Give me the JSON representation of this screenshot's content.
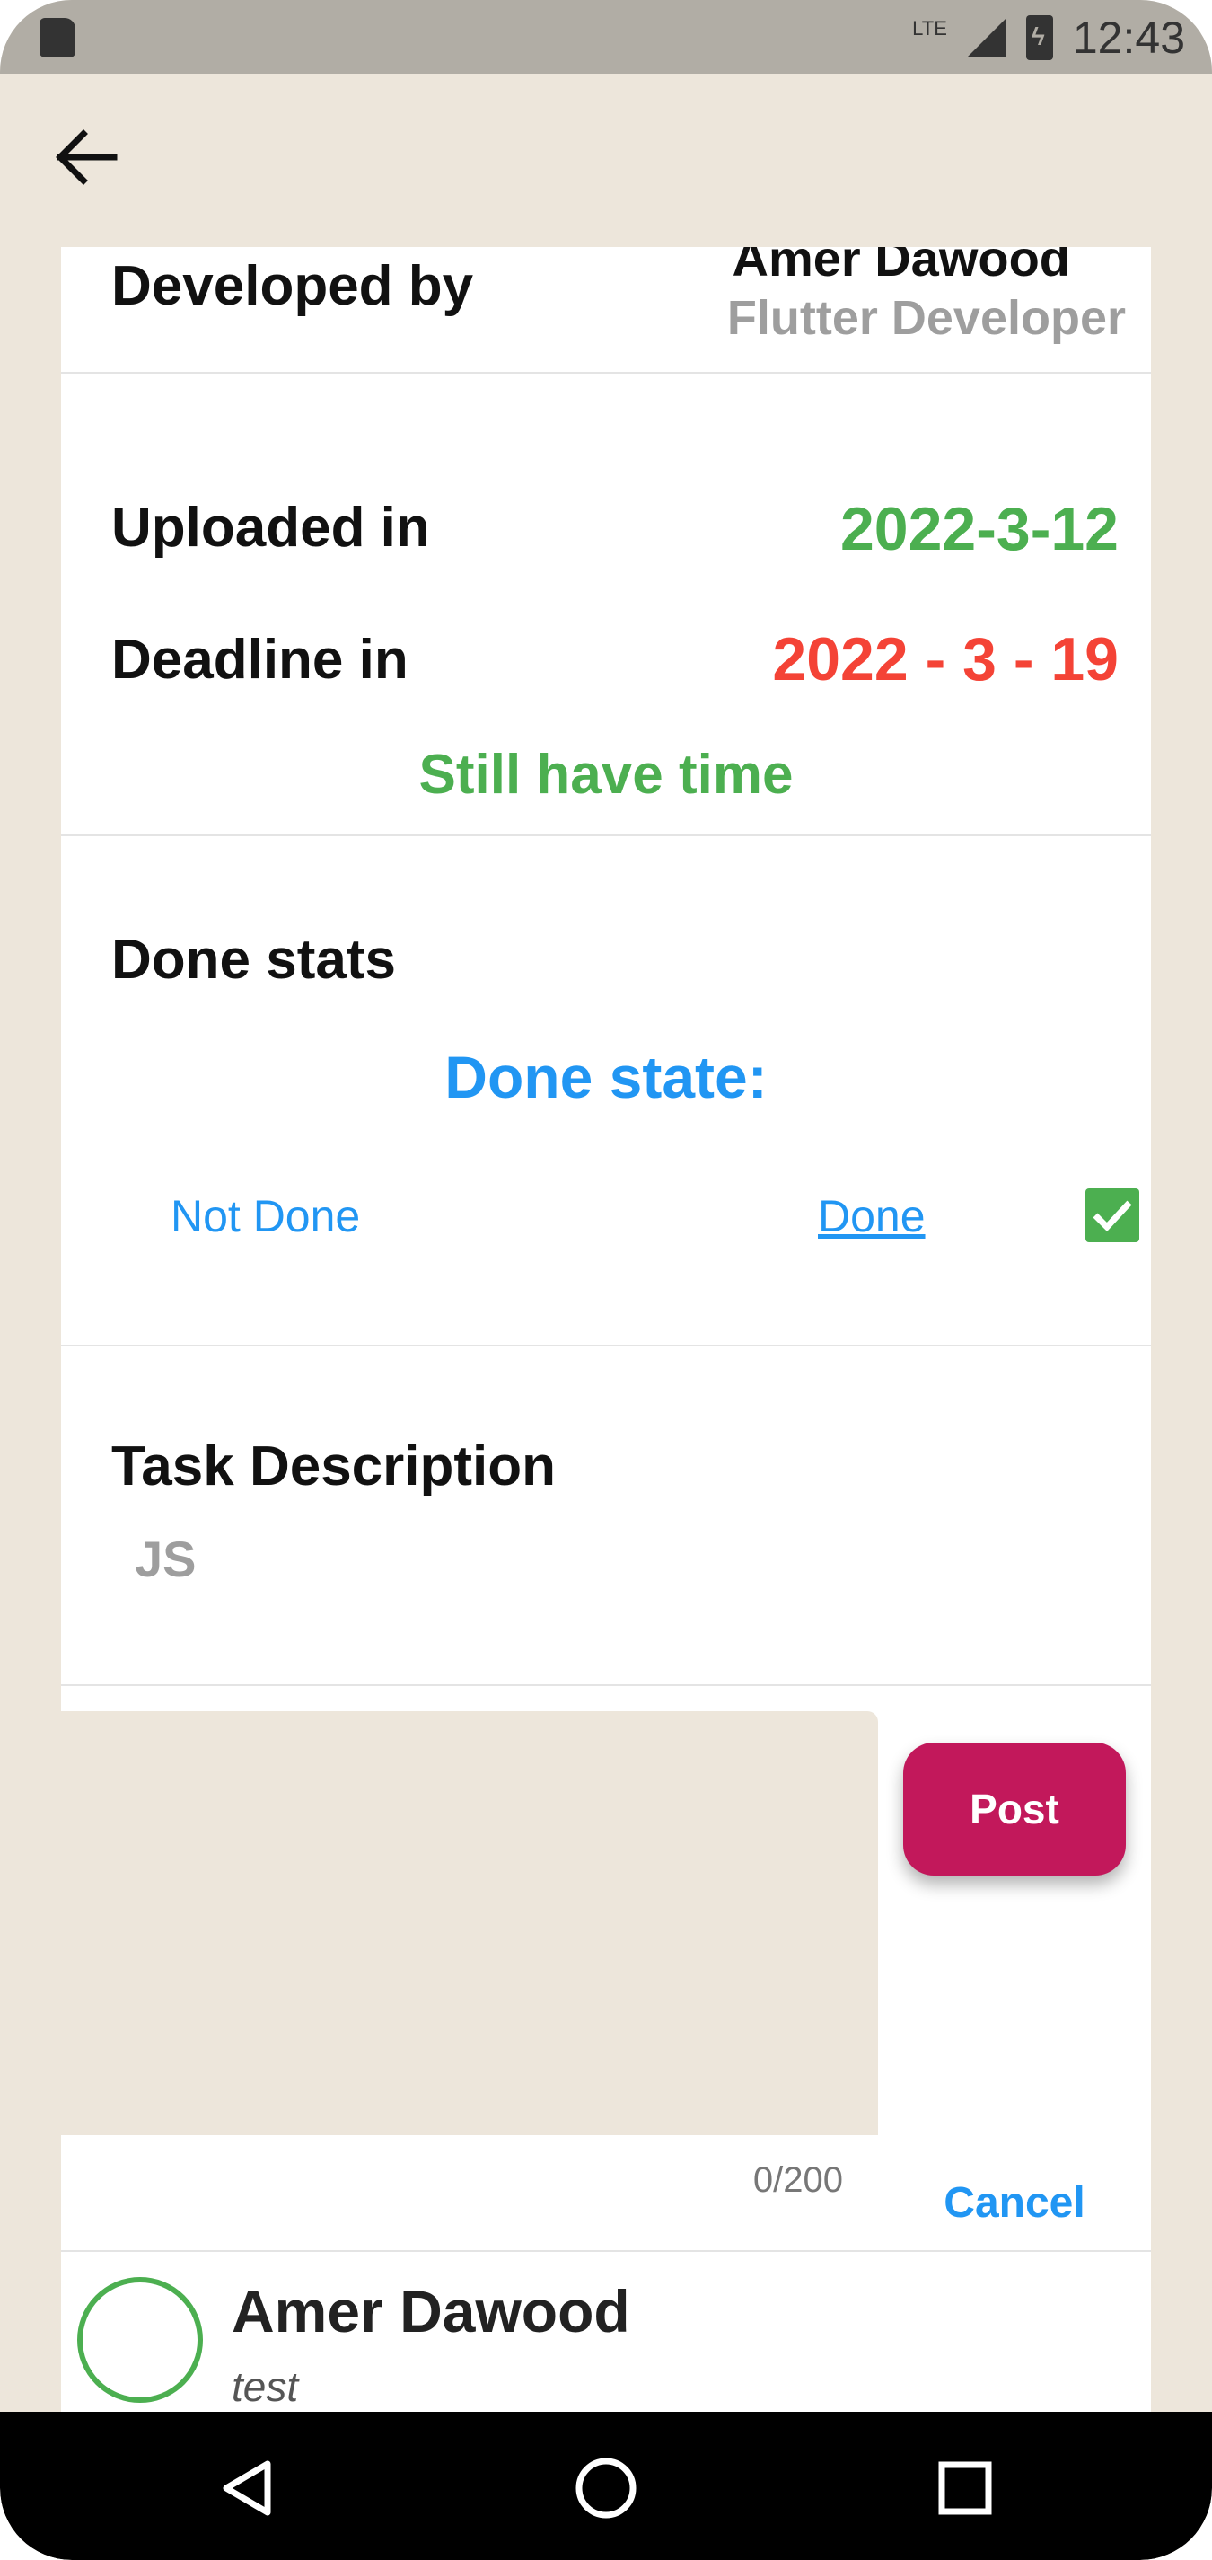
{
  "status_bar": {
    "network": "LTE",
    "time": "12:43"
  },
  "developer": {
    "label": "Developed by",
    "name": "Amer Dawood",
    "role": "Flutter Developer"
  },
  "dates": {
    "uploaded_label": "Uploaded in",
    "uploaded_value": "2022-3-12",
    "deadline_label": "Deadline in",
    "deadline_value": "2022 - 3 - 19",
    "status": "Still have time"
  },
  "done": {
    "section_title": "Done stats",
    "state_title": "Done state:",
    "not_done_label": "Not Done",
    "done_label": "Done",
    "checked": true
  },
  "description": {
    "title": "Task Description",
    "text": "JS"
  },
  "comment_form": {
    "post_label": "Post",
    "cancel_label": "Cancel",
    "counter": "0/200",
    "input_value": ""
  },
  "comments": [
    {
      "author": "Amer Dawood",
      "text": "test"
    }
  ],
  "colors": {
    "accent_green": "#4caf50",
    "deadline_red": "#f44336",
    "link_blue": "#2196f3",
    "post_button": "#c2185b",
    "background": "#ede6db"
  },
  "icons": {
    "back": "arrow-left-icon",
    "check": "check-icon",
    "nav_back": "triangle-back-icon",
    "nav_home": "circle-home-icon",
    "nav_recents": "square-recents-icon"
  }
}
